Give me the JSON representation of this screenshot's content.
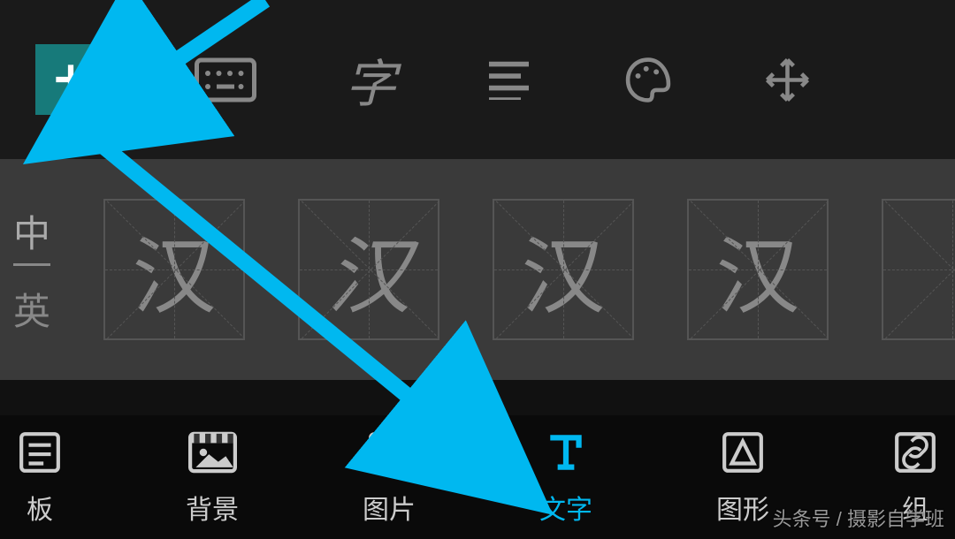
{
  "topToolbar": {
    "addButton": "add",
    "icons": [
      "keyboard",
      "font-style",
      "align",
      "palette",
      "move"
    ]
  },
  "langToggle": {
    "chinese": "中",
    "english": "英",
    "active": "chinese"
  },
  "previewChar": "汉",
  "bottomTabs": [
    {
      "id": "template",
      "label": "板",
      "icon": "template-icon"
    },
    {
      "id": "background",
      "label": "背景",
      "icon": "background-icon"
    },
    {
      "id": "image",
      "label": "图片",
      "icon": "image-icon"
    },
    {
      "id": "text",
      "label": "文字",
      "icon": "text-icon",
      "active": true
    },
    {
      "id": "shape",
      "label": "图形",
      "icon": "shape-icon"
    },
    {
      "id": "component",
      "label": "组",
      "icon": "link-icon"
    }
  ],
  "watermark": "头条号 / 摄影自学班",
  "annotations": {
    "arrow1": "points to add button",
    "arrow2": "points to text tab"
  }
}
